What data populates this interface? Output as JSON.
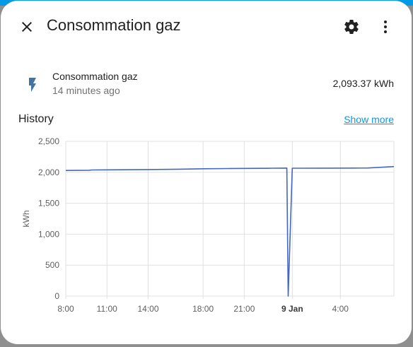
{
  "dialog": {
    "title": "Consommation gaz",
    "icons": {
      "close": "close-icon",
      "settings": "gear-icon",
      "more": "more-vertical-icon"
    }
  },
  "entity": {
    "icon": "flash-icon",
    "name": "Consommation gaz",
    "last_changed": "14 minutes ago",
    "state": "2,093.37 kWh"
  },
  "history": {
    "title": "History",
    "show_more": "Show more"
  },
  "colors": {
    "accent": "#039be5",
    "line": "#4467c4",
    "icon": "#44739e",
    "grid": "#e0e0e0"
  },
  "chart_data": {
    "type": "line",
    "ylabel": "kWh",
    "ylim": [
      0,
      2500
    ],
    "yticks": [
      "0",
      "500",
      "1,000",
      "1,500",
      "2,000",
      "2,500"
    ],
    "xticks": [
      "8:00",
      "11:00",
      "14:00",
      "18:00",
      "21:00",
      "9 Jan",
      "4:00"
    ],
    "bold_xtick": "9 Jan",
    "x_hours_from_start": [
      0,
      1.7,
      1.9,
      3.2,
      5.0,
      6.0,
      8.3,
      9.0,
      10.0,
      11.8,
      12.0,
      14.0,
      15.0,
      16.1,
      16.2,
      16.5,
      16.7,
      17.0,
      19.0,
      21.0,
      22.0,
      23.7,
      23.9
    ],
    "x_start": "8:00",
    "series": [
      {
        "values": [
          2030,
          2033,
          2038,
          2040,
          2042,
          2045,
          2050,
          2052,
          2057,
          2060,
          2062,
          2064,
          2066,
          2068,
          0,
          2066,
          2066,
          2066,
          2067,
          2068,
          2070,
          2090,
          2093
        ]
      }
    ]
  }
}
